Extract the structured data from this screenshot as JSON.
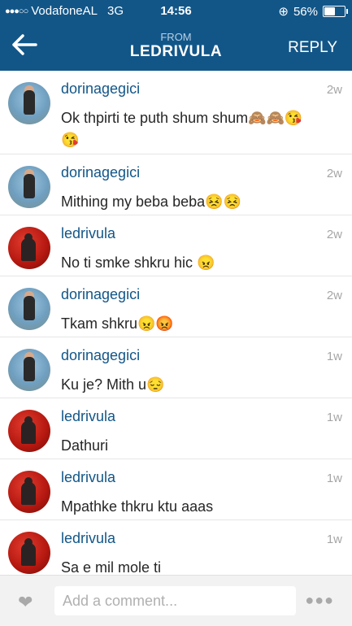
{
  "status_bar": {
    "carrier": "VodafoneAL",
    "network": "3G",
    "time": "14:56",
    "battery": "56%",
    "battery_level": 0.56
  },
  "header": {
    "from_label": "FROM",
    "title": "LEDRIVULA",
    "reply_label": "REPLY",
    "color": "#125688"
  },
  "comments": [
    {
      "username": "dorinagegici",
      "time": "2w",
      "text": "Ok thpirti te puth shum shum🙈🙈😘😘",
      "avatar": "girl-beach-avatar"
    },
    {
      "username": "dorinagegici",
      "time": "2w",
      "text": "Mithing my beba beba😣😣",
      "avatar": "girl-beach-avatar"
    },
    {
      "username": "ledrivula",
      "time": "2w",
      "text": "No ti smke shkru hic 😠",
      "avatar": "red-silhouette-avatar"
    },
    {
      "username": "dorinagegici",
      "time": "2w",
      "text": "Tkam shkru😠😡",
      "avatar": "girl-beach-avatar"
    },
    {
      "username": "dorinagegici",
      "time": "1w",
      "text": "Ku je? Mith u😔",
      "avatar": "girl-beach-avatar"
    },
    {
      "username": "ledrivula",
      "time": "1w",
      "text": "Dathuri",
      "avatar": "red-silhouette-avatar"
    },
    {
      "username": "ledrivula",
      "time": "1w",
      "text": "Mpathke thkru ktu aaas",
      "avatar": "red-silhouette-avatar"
    },
    {
      "username": "ledrivula",
      "time": "1w",
      "text": "Sa e mil mole ti",
      "avatar": "red-silhouette-avatar"
    }
  ],
  "footer": {
    "placeholder": "Add a comment...",
    "like_icon": "heart-icon",
    "more_icon": "more-dots-icon"
  }
}
